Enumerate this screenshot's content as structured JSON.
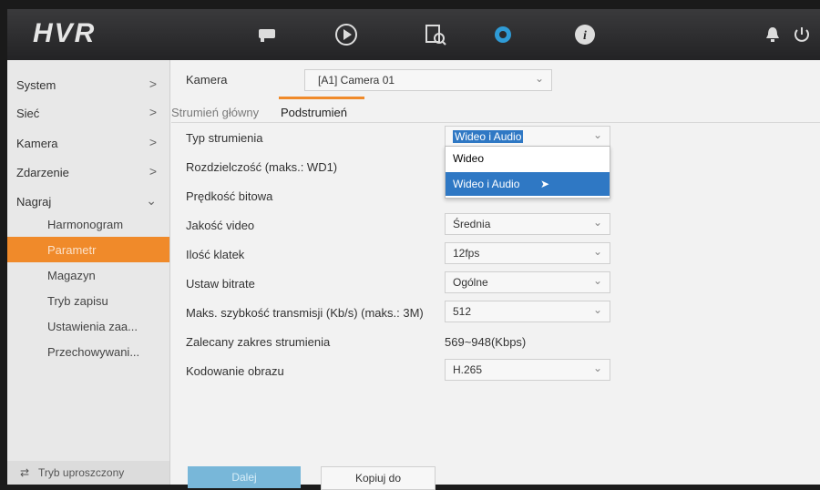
{
  "header": {
    "logo": "HVR",
    "icons": [
      "camera-icon",
      "playback-icon",
      "search-icon",
      "settings-icon",
      "info-icon",
      "alarm-icon",
      "power-icon"
    ]
  },
  "sidebar": {
    "items": [
      {
        "label": "System",
        "arrow": ">"
      },
      {
        "label": "Sieć",
        "arrow": ">"
      },
      {
        "label": "Kamera",
        "arrow": ">"
      },
      {
        "label": "Zdarzenie",
        "arrow": ">"
      },
      {
        "label": "Nagraj",
        "arrow": "⌄"
      }
    ],
    "subitems": [
      {
        "label": "Harmonogram"
      },
      {
        "label": "Parametr",
        "active": true
      },
      {
        "label": "Magazyn"
      },
      {
        "label": "Tryb zapisu"
      },
      {
        "label": "Ustawienia zaa..."
      },
      {
        "label": "Przechowywani..."
      }
    ],
    "bottom": "Tryb uproszczony"
  },
  "main": {
    "camera_label": "Kamera",
    "camera_value": "[A1] Camera 01",
    "tabs": [
      {
        "label": "Strumień główny",
        "active": false
      },
      {
        "label": "Podstrumień",
        "active": true
      }
    ],
    "rows": [
      {
        "label": "Typ strumienia",
        "value": "Wideo i Audio",
        "dropdown": true
      },
      {
        "label": "Rozdzielczość (maks.: WD1)",
        "value": "",
        "dropdown": true
      },
      {
        "label": "Prędkość bitowa",
        "value": "",
        "dropdown": true
      },
      {
        "label": "Jakość video",
        "value": "Średnia",
        "dropdown": true
      },
      {
        "label": "Ilość klatek",
        "value": "12fps",
        "dropdown": true
      },
      {
        "label": "Ustaw bitrate",
        "value": "Ogólne",
        "dropdown": true
      },
      {
        "label": "Maks. szybkość transmisji (Kb/s) (maks.: 3M)",
        "value": "512",
        "dropdown": true
      },
      {
        "label": "Zalecany zakres strumienia",
        "value": "569~948(Kbps)",
        "dropdown": false
      },
      {
        "label": "Kodowanie obrazu",
        "value": "H.265",
        "dropdown": true
      }
    ],
    "dropdown_options": [
      {
        "label": "Wideo",
        "selected": false
      },
      {
        "label": "Wideo i Audio",
        "selected": true
      }
    ],
    "buttons": {
      "next": "Dalej",
      "copy": "Kopiuj do"
    }
  },
  "colors": {
    "accent": "#f08a2a",
    "selection": "#2f78c4",
    "topbar": "#2b2b2d",
    "gear": "#2f9bd6"
  }
}
